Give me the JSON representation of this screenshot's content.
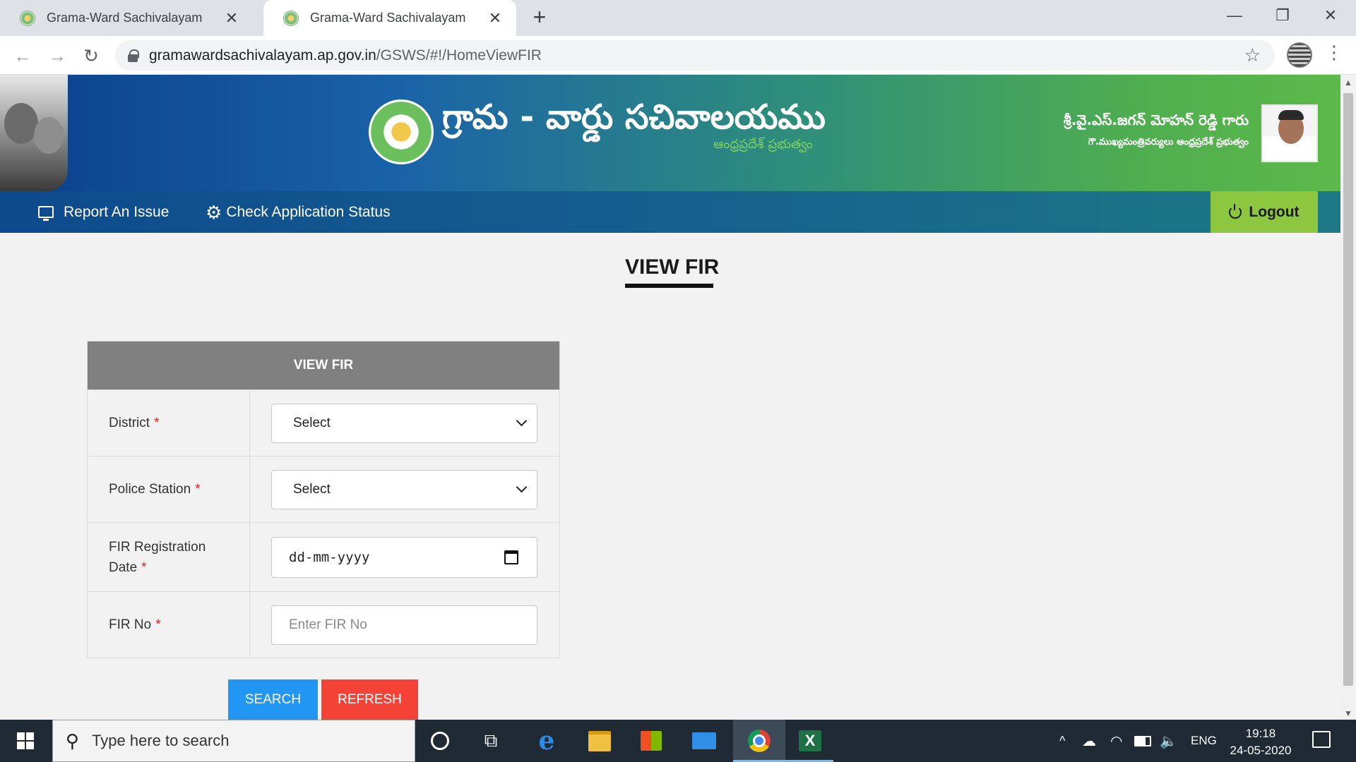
{
  "browser": {
    "tabs": [
      {
        "title": "Grama-Ward Sachivalayam",
        "active": false
      },
      {
        "title": "Grama-Ward Sachivalayam",
        "active": true
      }
    ],
    "tab_close_glyph": "✕",
    "new_tab_glyph": "+",
    "window_controls": {
      "minimize": "—",
      "maximize": "❐",
      "close": "✕"
    },
    "nav": {
      "back": "←",
      "forward": "→",
      "reload": "↻"
    },
    "url": {
      "host": "gramawardsachivalayam.ap.gov.in",
      "path": "/GSWS/#!/HomeViewFIR"
    },
    "star_glyph": "☆",
    "menu_glyph": "⋮"
  },
  "header": {
    "site_title": "గ్రామ - వార్డు సచివాలయము",
    "site_subtitle": "ఆంధ్రప్రదేశ్ ప్రభుత్వం",
    "cm_name": "శ్రీ.వై.ఎస్.జగన్ మోహన్ రెడ్డి గారు",
    "cm_title": "గౌ.ముఖ్యమంత్రివర్యులు ఆంధ్రప్రదేశ్ ప్రభుత్వం"
  },
  "navbar": {
    "report_issue": "Report An Issue",
    "check_status": "Check Application Status",
    "gear_glyph": "⚙",
    "logout": "Logout"
  },
  "page": {
    "heading": "VIEW FIR",
    "form": {
      "header": "VIEW FIR",
      "required_mark": "*",
      "fields": {
        "district": {
          "label": "District",
          "value": "Select"
        },
        "police_station": {
          "label": "Police Station",
          "value": "Select"
        },
        "fir_date": {
          "label_line1": "FIR Registration",
          "label_line2": "Date",
          "value": "dd-mm-yyyy"
        },
        "fir_no": {
          "label": "FIR No",
          "placeholder": "Enter FIR No"
        }
      }
    },
    "buttons": {
      "search": "SEARCH",
      "refresh": "REFRESH"
    }
  },
  "scrollbar": {
    "up": "▲",
    "down": "▼"
  },
  "taskbar": {
    "search_placeholder": "Type here to search",
    "search_glyph": "⚲",
    "taskview_glyph": "⧉",
    "edge_glyph": "e",
    "tray": {
      "chevron": "^",
      "cloud": "☁",
      "wifi": "◠",
      "volume": "🔈",
      "language": "ENG",
      "time": "19:18",
      "date": "24-05-2020"
    }
  }
}
